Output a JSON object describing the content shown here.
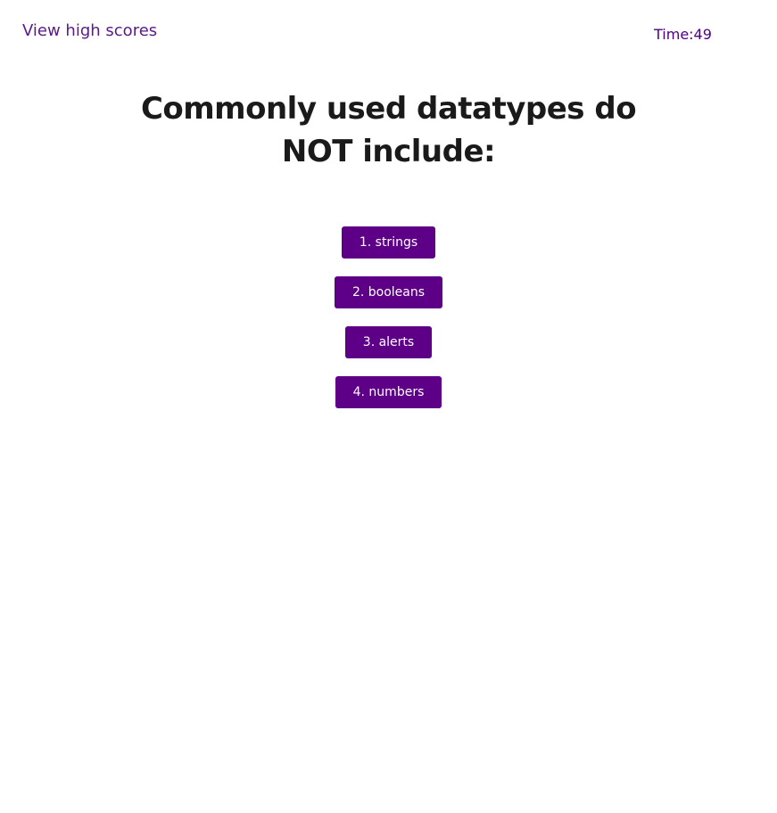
{
  "header": {
    "high_scores_label": "View high scores",
    "timer_text": "Time:49"
  },
  "quiz": {
    "question": "Commonly used datatypes do NOT include:",
    "choices": [
      {
        "label": "1. strings"
      },
      {
        "label": "2. booleans"
      },
      {
        "label": "3. alerts"
      },
      {
        "label": "4. numbers"
      }
    ]
  },
  "colors": {
    "accent": "#5e0087",
    "link": "#5a1a8a",
    "heading": "#1a1a1a",
    "background": "#ffffff"
  }
}
